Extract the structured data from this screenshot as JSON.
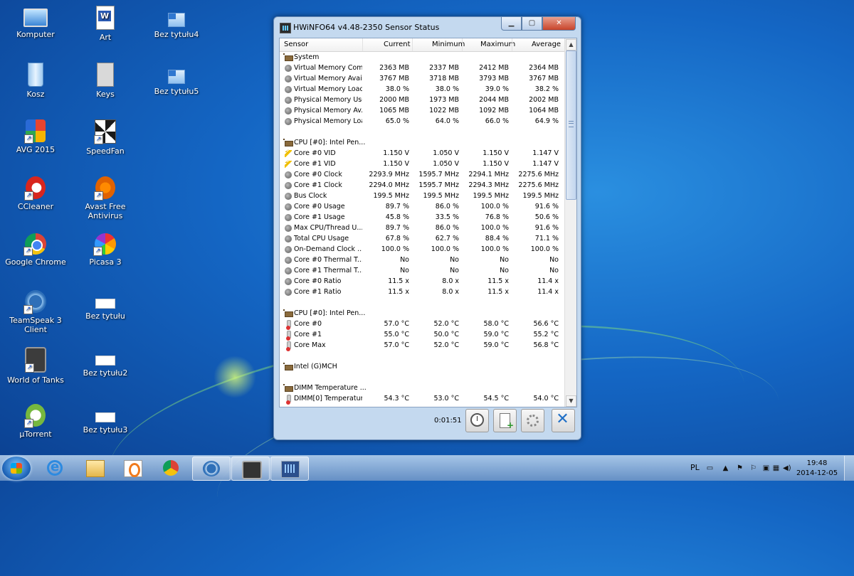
{
  "desktop": {
    "icons": [
      {
        "label": "Komputer"
      },
      {
        "label": "Art"
      },
      {
        "label": "Bez tytułu4"
      },
      {
        "label": "Kosz"
      },
      {
        "label": "Keys"
      },
      {
        "label": "Bez tytułu5"
      },
      {
        "label": "AVG 2015"
      },
      {
        "label": "SpeedFan"
      },
      {
        "label": "CCleaner"
      },
      {
        "label": "Avast Free Antivirus"
      },
      {
        "label": "Google Chrome"
      },
      {
        "label": "Picasa 3"
      },
      {
        "label": "TeamSpeak 3 Client"
      },
      {
        "label": "Bez tytułu"
      },
      {
        "label": "World of Tanks"
      },
      {
        "label": "Bez tytułu2"
      },
      {
        "label": "µTorrent"
      },
      {
        "label": "Bez tytułu3"
      }
    ]
  },
  "window": {
    "title": "HWiNFO64 v4.48-2350 Sensor Status",
    "headers": {
      "sensor": "Sensor",
      "current": "Current",
      "minimum": "Minimum",
      "maximum": "Maximum",
      "average": "Average"
    },
    "rows": [
      {
        "type": "group",
        "icon": "chip",
        "name": "System",
        "cur": "",
        "min": "",
        "max": "",
        "avg": ""
      },
      {
        "type": "row",
        "icon": "sensor",
        "name": "Virtual Memory Com...",
        "cur": "2363 MB",
        "min": "2337 MB",
        "max": "2412 MB",
        "avg": "2364 MB"
      },
      {
        "type": "row",
        "icon": "sensor",
        "name": "Virtual Memory Avai...",
        "cur": "3767 MB",
        "min": "3718 MB",
        "max": "3793 MB",
        "avg": "3767 MB"
      },
      {
        "type": "row",
        "icon": "sensor",
        "name": "Virtual Memory Load",
        "cur": "38.0 %",
        "min": "38.0 %",
        "max": "39.0 %",
        "avg": "38.2 %"
      },
      {
        "type": "row",
        "icon": "sensor",
        "name": "Physical Memory Used",
        "cur": "2000 MB",
        "min": "1973 MB",
        "max": "2044 MB",
        "avg": "2002 MB"
      },
      {
        "type": "row",
        "icon": "sensor",
        "name": "Physical Memory Av...",
        "cur": "1065 MB",
        "min": "1022 MB",
        "max": "1092 MB",
        "avg": "1064 MB"
      },
      {
        "type": "row",
        "icon": "sensor",
        "name": "Physical Memory Load",
        "cur": "65.0 %",
        "min": "64.0 %",
        "max": "66.0 %",
        "avg": "64.9 %"
      },
      {
        "type": "blank",
        "icon": "",
        "name": "",
        "cur": "",
        "min": "",
        "max": "",
        "avg": ""
      },
      {
        "type": "group",
        "icon": "chip",
        "name": "CPU [#0]: Intel Pen...",
        "cur": "",
        "min": "",
        "max": "",
        "avg": ""
      },
      {
        "type": "row",
        "icon": "volt",
        "name": "Core #0 VID",
        "cur": "1.150 V",
        "min": "1.050 V",
        "max": "1.150 V",
        "avg": "1.147 V"
      },
      {
        "type": "row",
        "icon": "volt",
        "name": "Core #1 VID",
        "cur": "1.150 V",
        "min": "1.050 V",
        "max": "1.150 V",
        "avg": "1.147 V"
      },
      {
        "type": "row",
        "icon": "sensor",
        "name": "Core #0 Clock",
        "cur": "2293.9 MHz",
        "min": "1595.7 MHz",
        "max": "2294.1 MHz",
        "avg": "2275.6 MHz"
      },
      {
        "type": "row",
        "icon": "sensor",
        "name": "Core #1 Clock",
        "cur": "2294.0 MHz",
        "min": "1595.7 MHz",
        "max": "2294.3 MHz",
        "avg": "2275.6 MHz"
      },
      {
        "type": "row",
        "icon": "sensor",
        "name": "Bus Clock",
        "cur": "199.5 MHz",
        "min": "199.5 MHz",
        "max": "199.5 MHz",
        "avg": "199.5 MHz"
      },
      {
        "type": "row",
        "icon": "sensor",
        "name": "Core #0 Usage",
        "cur": "89.7 %",
        "min": "86.0 %",
        "max": "100.0 %",
        "avg": "91.6 %"
      },
      {
        "type": "row",
        "icon": "sensor",
        "name": "Core #1 Usage",
        "cur": "45.8 %",
        "min": "33.5 %",
        "max": "76.8 %",
        "avg": "50.6 %"
      },
      {
        "type": "row",
        "icon": "sensor",
        "name": "Max CPU/Thread U...",
        "cur": "89.7 %",
        "min": "86.0 %",
        "max": "100.0 %",
        "avg": "91.6 %"
      },
      {
        "type": "row",
        "icon": "sensor",
        "name": "Total CPU Usage",
        "cur": "67.8 %",
        "min": "62.7 %",
        "max": "88.4 %",
        "avg": "71.1 %"
      },
      {
        "type": "row",
        "icon": "sensor",
        "name": "On-Demand Clock ...",
        "cur": "100.0 %",
        "min": "100.0 %",
        "max": "100.0 %",
        "avg": "100.0 %"
      },
      {
        "type": "row",
        "icon": "sensor",
        "name": "Core #0 Thermal T...",
        "cur": "No",
        "min": "No",
        "max": "No",
        "avg": "No"
      },
      {
        "type": "row",
        "icon": "sensor",
        "name": "Core #1 Thermal T...",
        "cur": "No",
        "min": "No",
        "max": "No",
        "avg": "No"
      },
      {
        "type": "row",
        "icon": "sensor",
        "name": "Core #0 Ratio",
        "cur": "11.5 x",
        "min": "8.0 x",
        "max": "11.5 x",
        "avg": "11.4 x"
      },
      {
        "type": "row",
        "icon": "sensor",
        "name": "Core #1 Ratio",
        "cur": "11.5 x",
        "min": "8.0 x",
        "max": "11.5 x",
        "avg": "11.4 x"
      },
      {
        "type": "blank",
        "icon": "",
        "name": "",
        "cur": "",
        "min": "",
        "max": "",
        "avg": ""
      },
      {
        "type": "group",
        "icon": "chip",
        "name": "CPU [#0]: Intel Pen...",
        "cur": "",
        "min": "",
        "max": "",
        "avg": ""
      },
      {
        "type": "row",
        "icon": "therm",
        "name": "Core #0",
        "cur": "57.0 °C",
        "min": "52.0 °C",
        "max": "58.0 °C",
        "avg": "56.6 °C"
      },
      {
        "type": "row",
        "icon": "therm",
        "name": "Core #1",
        "cur": "55.0 °C",
        "min": "50.0 °C",
        "max": "59.0 °C",
        "avg": "55.2 °C"
      },
      {
        "type": "row",
        "icon": "therm",
        "name": "Core Max",
        "cur": "57.0 °C",
        "min": "52.0 °C",
        "max": "59.0 °C",
        "avg": "56.8 °C"
      },
      {
        "type": "blank",
        "icon": "",
        "name": "",
        "cur": "",
        "min": "",
        "max": "",
        "avg": ""
      },
      {
        "type": "group",
        "icon": "chip",
        "name": "Intel (G)MCH",
        "cur": "",
        "min": "",
        "max": "",
        "avg": ""
      },
      {
        "type": "blank",
        "icon": "",
        "name": "",
        "cur": "",
        "min": "",
        "max": "",
        "avg": ""
      },
      {
        "type": "group",
        "icon": "chip",
        "name": "DIMM Temperature ...",
        "cur": "",
        "min": "",
        "max": "",
        "avg": ""
      },
      {
        "type": "row",
        "icon": "therm",
        "name": "DIMM[0] Temperature",
        "cur": "54.3 °C",
        "min": "53.0 °C",
        "max": "54.5 °C",
        "avg": "54.0 °C"
      }
    ],
    "timer": "0:01:51"
  },
  "taskbar": {
    "tray": {
      "lang": "PL",
      "time": "19:48",
      "date": "2014-12-05"
    }
  }
}
